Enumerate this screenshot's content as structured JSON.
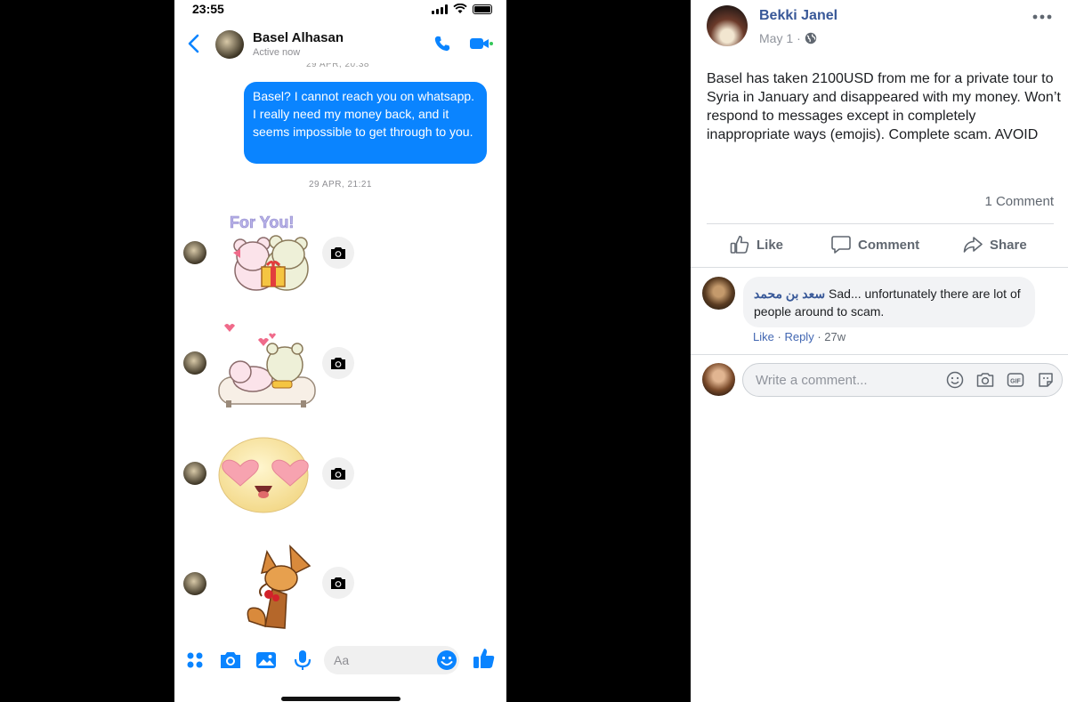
{
  "messenger": {
    "status_time": "23:55",
    "contact_name": "Basel Alhasan",
    "contact_status": "Active now",
    "partial_timestamp": "29 APR, 20:38",
    "sent_message": "Basel? I cannot reach you on whatsapp. I really need my money back, and it seems impossible to get through to you.",
    "timestamp": "29 APR, 21:21",
    "sticker_caption": "For You!",
    "composer_placeholder": "Aa",
    "colors": {
      "accent": "#0a84ff",
      "active_green": "#34c759"
    }
  },
  "facebook_post": {
    "author": "Bekki Janel",
    "date": "May 1",
    "visibility_sep": "·",
    "body": "Basel has taken 2100USD from me for a private tour to Syria in January and disappeared with my money. Won’t respond to messages except in completely inappropriate ways (emojis). Complete scam. AVOID",
    "comment_count": "1 Comment",
    "actions": {
      "like": "Like",
      "comment": "Comment",
      "share": "Share"
    },
    "comment": {
      "author": "سعد بن محمد",
      "text": "Sad... unfortunately there are lot of people around to scam.",
      "like": "Like",
      "dot": "·",
      "reply": "Reply",
      "age": "27w"
    },
    "write_placeholder": "Write a comment...",
    "colors": {
      "link": "#385898",
      "muted": "#606770"
    }
  }
}
